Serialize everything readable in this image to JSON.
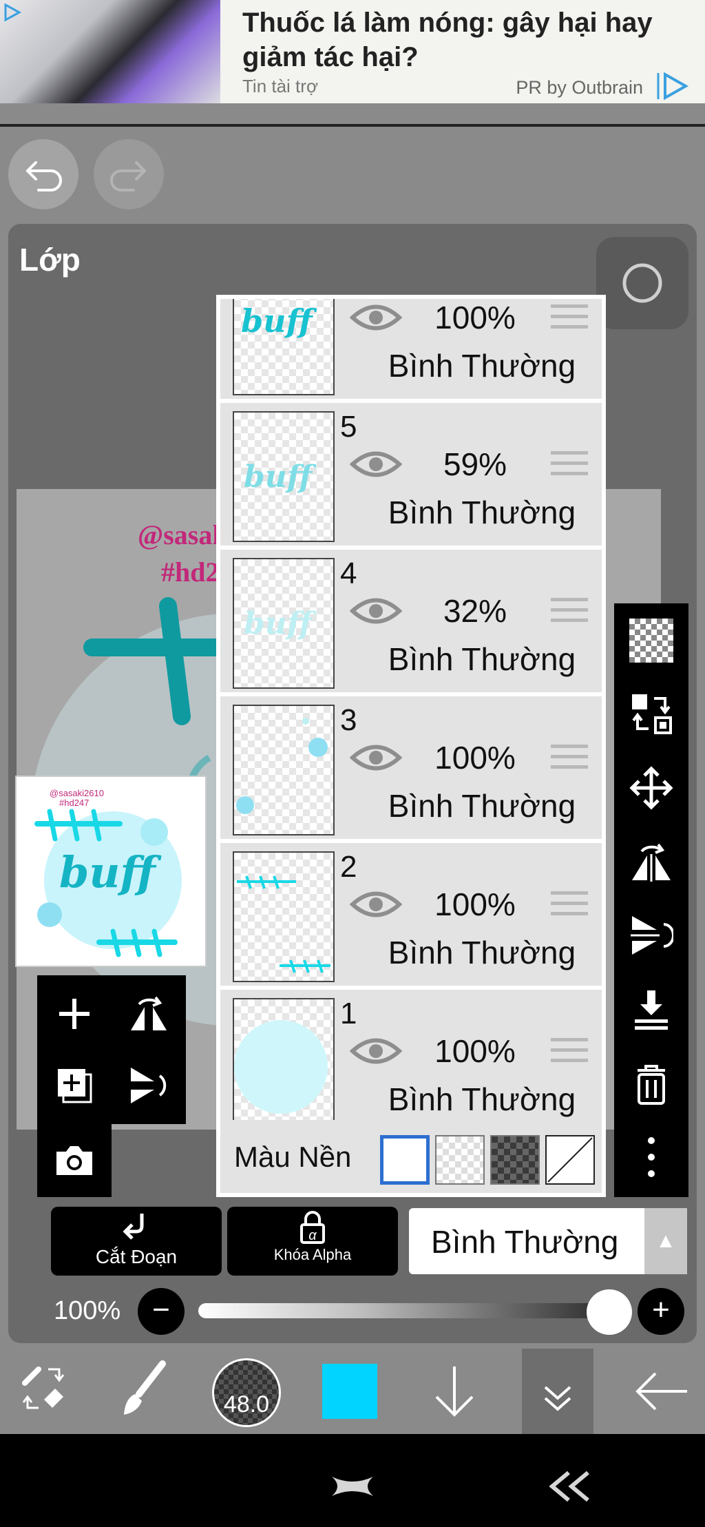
{
  "ad": {
    "title": "Thuốc lá làm nóng: gây hại hay giảm tác hại?",
    "sponsor": "Tin tài trợ",
    "provider": "PR by Outbrain"
  },
  "panel": {
    "title": "Lớp"
  },
  "layers": [
    {
      "number": "",
      "opacity": "100%",
      "blend": "Bình Thường"
    },
    {
      "number": "5",
      "opacity": "59%",
      "blend": "Bình Thường"
    },
    {
      "number": "4",
      "opacity": "32%",
      "blend": "Bình Thường"
    },
    {
      "number": "3",
      "opacity": "100%",
      "blend": "Bình Thường"
    },
    {
      "number": "2",
      "opacity": "100%",
      "blend": "Bình Thường"
    },
    {
      "number": "1",
      "opacity": "100%",
      "blend": "Bình Thường"
    }
  ],
  "background": {
    "label": "Màu Nền"
  },
  "bottom": {
    "clip_label": "Cắt Đoạn",
    "alpha_label": "Khóa Alpha",
    "blend_value": "Bình Thường",
    "opacity_value": "100%",
    "opacity_level": 1.0
  },
  "toolbar": {
    "brush_size": "48.0",
    "color": "#00d4ff"
  },
  "watermark": {
    "line1": "@sasak",
    "line2": "#hd2",
    "thumb_line1": "@sasaki2610",
    "thumb_line2": "#hd247",
    "thumb_word": "buff"
  }
}
